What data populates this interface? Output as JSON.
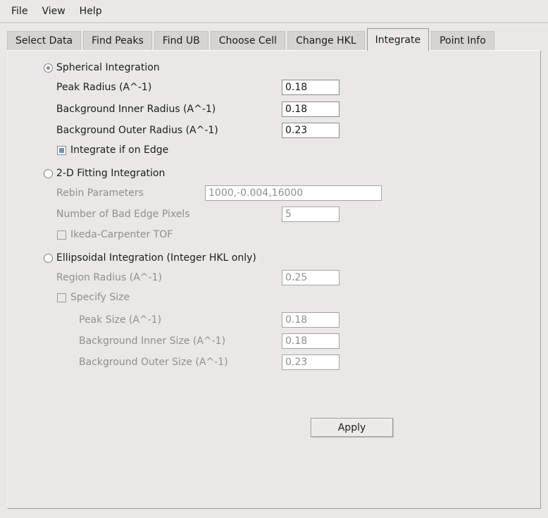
{
  "window": {
    "bg": "#e9e8e6",
    "accent_blue": "#6e93c0"
  },
  "menu": {
    "items": [
      "File",
      "View",
      "Help"
    ]
  },
  "tabs": [
    "Select Data",
    "Find Peaks",
    "Find UB",
    "Choose Cell",
    "Change HKL",
    "Integrate",
    "Point Info"
  ],
  "selected_tab": "Integrate",
  "spherical": {
    "label": "Spherical Integration",
    "selected": true,
    "peak_radius": {
      "label": "Peak Radius (A^-1)",
      "value": "0.18"
    },
    "bg_inner_radius": {
      "label": "Background Inner Radius (A^-1)",
      "value": "0.18"
    },
    "bg_outer_radius": {
      "label": "Background Outer Radius (A^-1)",
      "value": "0.23"
    },
    "integrate_edge": {
      "label": "Integrate if on Edge",
      "checked": true
    }
  },
  "fitting2d": {
    "label": "2-D Fitting Integration",
    "selected": false,
    "rebin": {
      "label": "Rebin Parameters",
      "value": "1000,-0.004,16000"
    },
    "bad_edge": {
      "label": "Number of Bad Edge Pixels",
      "value": "5"
    },
    "ikeda": {
      "label": "Ikeda-Carpenter TOF",
      "checked": false
    }
  },
  "ellipsoidal": {
    "label": "Ellipsoidal Integration (Integer HKL only)",
    "selected": false,
    "region_radius": {
      "label": "Region Radius (A^-1)",
      "value": "0.25"
    },
    "specify_size": {
      "label": "Specify Size",
      "checked": false
    },
    "peak_size": {
      "label": "Peak Size (A^-1)",
      "value": "0.18"
    },
    "bg_inner_size": {
      "label": "Background Inner Size (A^-1)",
      "value": "0.18"
    },
    "bg_outer_size": {
      "label": "Background Outer Size (A^-1)",
      "value": "0.23"
    }
  },
  "apply": {
    "label": "Apply"
  }
}
